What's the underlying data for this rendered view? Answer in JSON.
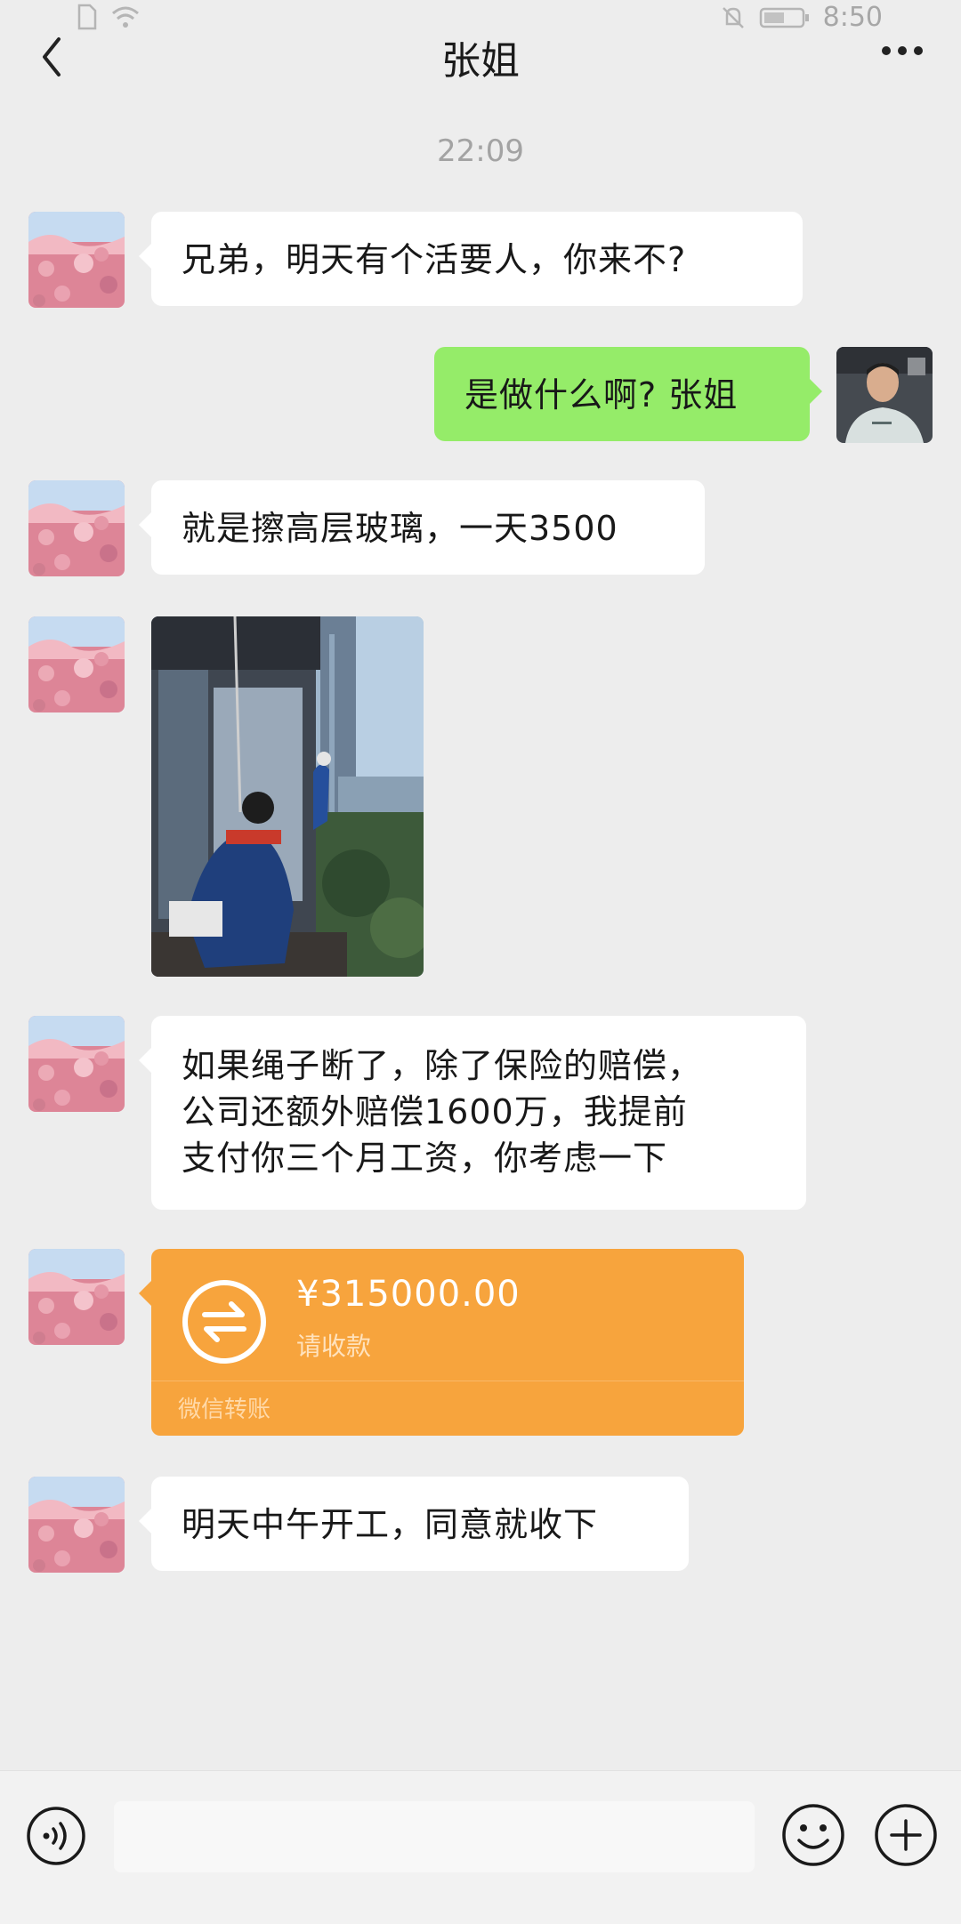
{
  "status_bar": {
    "time": "8:50"
  },
  "header": {
    "title": "张姐"
  },
  "timestamp": "22:09",
  "messages": {
    "m1": "兄弟，明天有个活要人，你来不?",
    "m2": "是做什么啊? 张姐",
    "m3": "就是擦高层玻璃，一天3500",
    "m5_line1": "如果绳子断了，除了保险的赔偿，",
    "m5_line2": "公司还额外赔偿1600万，我提前",
    "m5_line3": "支付你三个月工资，你考虑一下",
    "m7": "明天中午开工，同意就收下"
  },
  "transfer": {
    "amount": "¥315000.00",
    "note": "请收款",
    "brand": "微信转账",
    "color": "#f7a43d"
  },
  "colors": {
    "background": "#ededed",
    "self_bubble": "#95ec69",
    "other_bubble": "#ffffff"
  },
  "icons": {
    "back": "chevron-left-icon",
    "more": "more-icon",
    "voice": "voice-icon",
    "emoji": "emoji-icon",
    "plus": "plus-icon",
    "transfer": "transfer-icon"
  }
}
